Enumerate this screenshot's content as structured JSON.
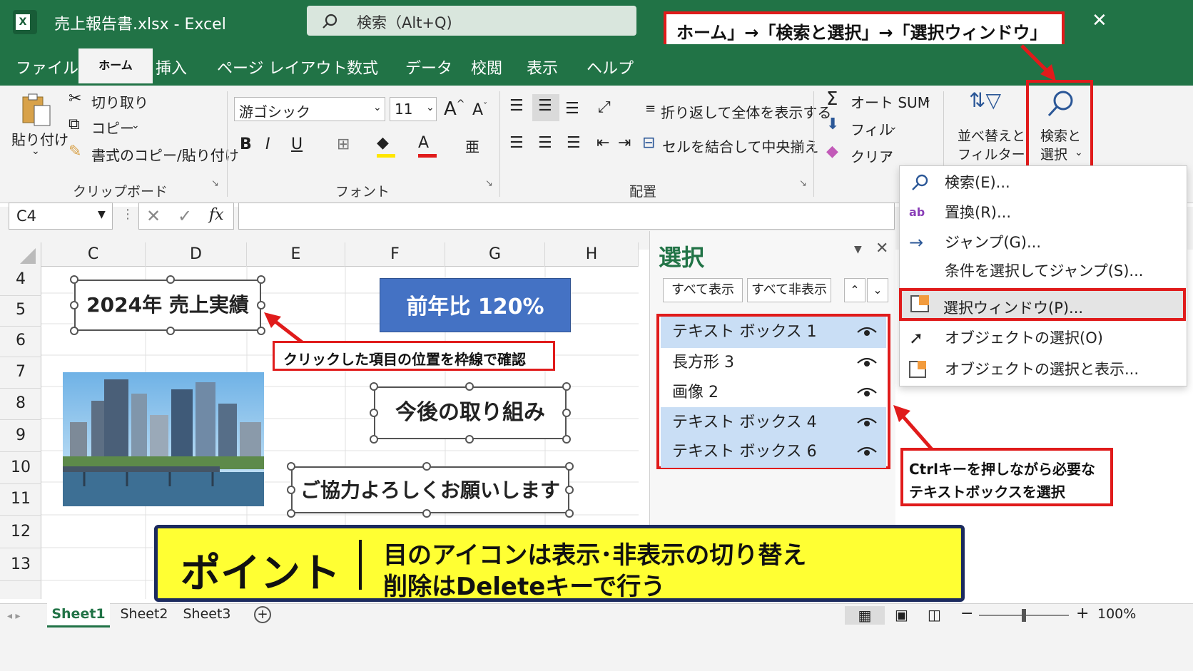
{
  "window": {
    "title": "売上報告書.xlsx - Excel",
    "search_placeholder": "検索（Alt+Q)",
    "close": "✕"
  },
  "tabs": [
    "ファイル",
    "ホーム",
    "挿入",
    "ページ レイアウト",
    "数式",
    "データ",
    "校閲",
    "表示",
    "ヘルプ"
  ],
  "annotations": {
    "top": "ホーム」→「検索と選択」→「選択ウィンドウ」",
    "click": "クリックした項目の位置を枠線で確認",
    "ctrl_line1": "Ctrlキーを押しながら必要な",
    "ctrl_line2": "テキストボックスを選択",
    "point_title": "ポイント",
    "point_line1": "目のアイコンは表示･非表示の切り替え",
    "point_line2": "削除はDeleteキーで行う"
  },
  "ribbon": {
    "paste": "貼り付け",
    "cut": "切り取り",
    "copy": "コピー",
    "format_painter": "書式のコピー/貼り付け",
    "clipboard_group": "クリップボード",
    "font_name": "游ゴシック",
    "font_size": "11",
    "font_group": "フォント",
    "wrap_text": "折り返して全体を表示する",
    "merge_center": "セルを結合して中央揃え",
    "align_group": "配置",
    "autosum": "オート SUM",
    "fill": "フィル",
    "clear": "クリア",
    "sort_filter_1": "並べ替えと",
    "sort_filter_2": "フィルター",
    "find_select_1": "検索と",
    "find_select_2": "選択"
  },
  "formula_bar": {
    "name_box": "C4",
    "fx": "fx",
    "value": ""
  },
  "columns": [
    "C",
    "D",
    "E",
    "F",
    "G",
    "H"
  ],
  "rows": [
    "4",
    "5",
    "6",
    "7",
    "8",
    "9",
    "10",
    "11",
    "12",
    "13"
  ],
  "sheet_objects": {
    "textbox1": "2024年 売上実績",
    "rect3": "前年比 120%",
    "textbox4": "今後の取り組み",
    "textbox6": "ご協力よろしくお願いします"
  },
  "selection_pane": {
    "title": "選択",
    "show_all": "すべて表示",
    "hide_all": "すべて非表示",
    "items": [
      {
        "label": "テキスト ボックス 1",
        "selected": true
      },
      {
        "label": "長方形 3",
        "selected": false
      },
      {
        "label": "画像 2",
        "selected": false
      },
      {
        "label": "テキスト ボックス 4",
        "selected": true
      },
      {
        "label": "テキスト ボックス 6",
        "selected": true
      }
    ]
  },
  "dropdown_menu": {
    "items": [
      "検索(E)...",
      "置換(R)...",
      "ジャンプ(G)...",
      "条件を選択してジャンプ(S)...",
      "選択ウィンドウ(P)...",
      "オブジェクトの選択(O)",
      "オブジェクトの選択と表示..."
    ]
  },
  "status_bar": {
    "sheets": [
      "Sheet1",
      "Sheet2",
      "Sheet3"
    ],
    "zoom": "100%"
  },
  "colors": {
    "excel_green": "#217346",
    "accent_red": "#e01b1b",
    "point_yellow": "#ffff33",
    "point_border": "#1b2a5e",
    "rect_blue": "#4472c4"
  }
}
